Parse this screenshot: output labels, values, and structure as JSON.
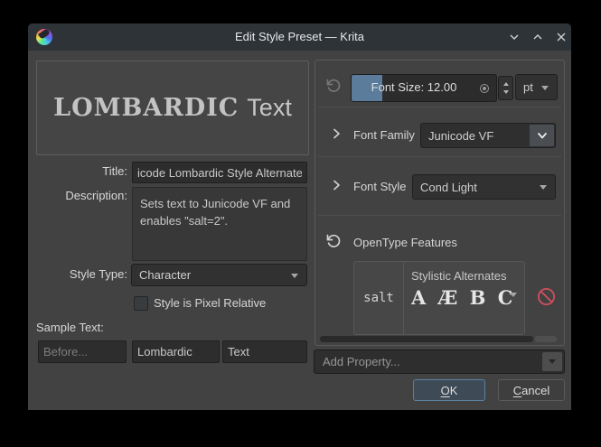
{
  "window": {
    "title": "Edit Style Preset — Krita"
  },
  "preview": {
    "styled_text": "LOMBARDIC",
    "plain_text": "Text"
  },
  "form": {
    "title_label": "Title:",
    "title_value": "icode Lombardic Style Alternate",
    "description_label": "Description:",
    "description_value": "Sets text to Junicode VF and enables \"salt=2\".",
    "style_type_label": "Style Type:",
    "style_type_value": "Character",
    "pixel_relative_label": "Style is Pixel Relative",
    "pixel_relative_checked": false,
    "sample_text_label": "Sample Text:",
    "sample_before_placeholder": "Before...",
    "sample_middle_value": "Lombardic",
    "sample_after_value": "Text"
  },
  "properties_panel": {
    "font_size": {
      "display_text": "Font Size: 12.00",
      "unit_value": "pt"
    },
    "font_family": {
      "label": "Font Family",
      "value": "Junicode VF"
    },
    "font_style": {
      "label": "Font Style",
      "value": "Cond Light"
    },
    "opentype": {
      "label": "OpenType Features",
      "feature_tag": "salt",
      "feature_name": "Stylistic Alternates",
      "glyph_preview": "A Æ B C D"
    },
    "add_property_placeholder": "Add Property..."
  },
  "buttons": {
    "ok_initial": "O",
    "ok_rest": "K",
    "cancel_initial": "C",
    "cancel_rest": "ancel"
  },
  "colors": {
    "titlebar": "#2e3338",
    "dialog_bg": "#424242",
    "accent_fill": "#5b7c9b",
    "focus_border": "#5b80a5",
    "danger": "#d24f5f"
  }
}
